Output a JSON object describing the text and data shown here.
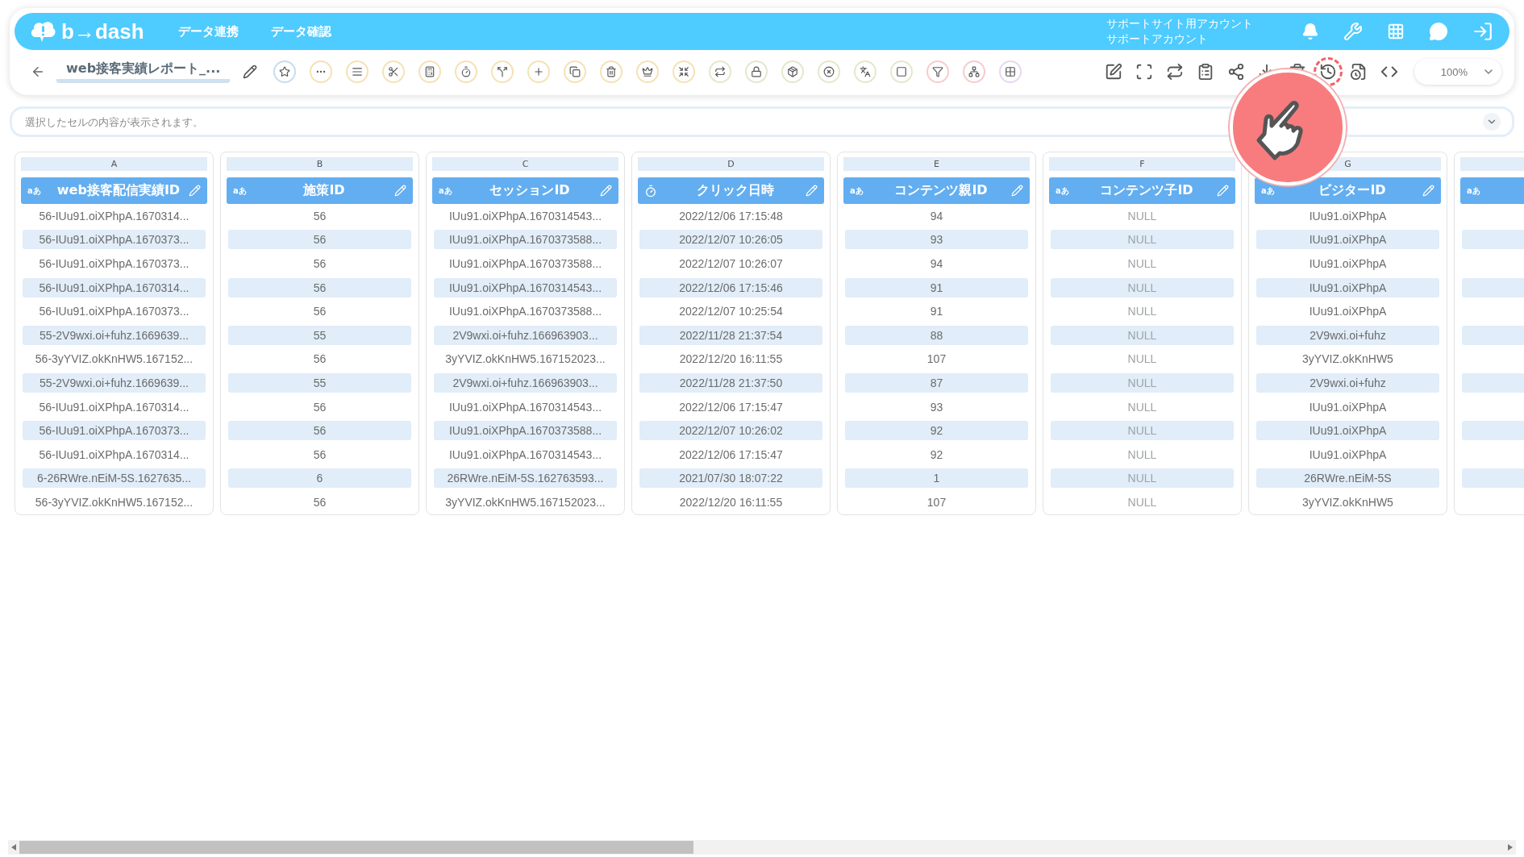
{
  "header": {
    "brand": "b→dash",
    "nav": [
      "データ連携",
      "データ確認"
    ],
    "account": [
      "サポートサイト用アカウント",
      "サポートアカウント"
    ]
  },
  "toolbar": {
    "report_title": "web接客実績レポート_...",
    "tools": [
      {
        "color": "#c9dcee"
      },
      {
        "color": "#f5e2b5"
      },
      {
        "color": "#f5e2b5"
      },
      {
        "color": "#f5e2b5"
      },
      {
        "color": "#f5e2b5"
      },
      {
        "color": "#f5e2b5"
      },
      {
        "color": "#f5e2b5"
      },
      {
        "color": "#f5e2b5"
      },
      {
        "color": "#f5e2b5"
      },
      {
        "color": "#f5e2b5"
      },
      {
        "color": "#f5e2b5"
      },
      {
        "color": "#f5e2b5"
      },
      {
        "color": "#e3e8cc"
      },
      {
        "color": "#e3e8cc"
      },
      {
        "color": "#e3e8cc"
      },
      {
        "color": "#e3e8cc"
      },
      {
        "color": "#e3e8cc"
      },
      {
        "color": "#e3e8cc"
      },
      {
        "color": "#f7cccc"
      },
      {
        "color": "#f7cccc"
      },
      {
        "color": "#ead6f2"
      }
    ],
    "actions": [
      {
        "highlighted": false
      },
      {
        "highlighted": false
      },
      {
        "highlighted": false
      },
      {
        "highlighted": false
      },
      {
        "highlighted": false
      },
      {
        "highlighted": false
      },
      {
        "highlighted": false
      },
      {
        "highlighted": true
      },
      {
        "highlighted": false
      },
      {
        "highlighted": false
      }
    ],
    "zoom": "100%"
  },
  "formula_bar": {
    "placeholder": "選択したセルの内容が表示されます。"
  },
  "columns": [
    {
      "letter": "A",
      "kind": "text",
      "type_label": "aあ",
      "title": "web接客配信実績ID",
      "dimmed": false,
      "cells": [
        "56-IUu91.oiXPhpA.1670314...",
        "56-IUu91.oiXPhpA.1670373...",
        "56-IUu91.oiXPhpA.1670373...",
        "56-IUu91.oiXPhpA.1670314...",
        "56-IUu91.oiXPhpA.1670373...",
        "55-2V9wxi.oi+fuhz.1669639...",
        "56-3yYVIZ.okKnHW5.167152...",
        "55-2V9wxi.oi+fuhz.1669639...",
        "56-IUu91.oiXPhpA.1670314...",
        "56-IUu91.oiXPhpA.1670373...",
        "56-IUu91.oiXPhpA.1670314...",
        "6-26RWre.nEiM-5S.1627635...",
        "56-3yYVIZ.okKnHW5.167152..."
      ]
    },
    {
      "letter": "B",
      "kind": "text",
      "type_label": "aあ",
      "title": "施策ID",
      "dimmed": false,
      "cells": [
        "56",
        "56",
        "56",
        "56",
        "56",
        "55",
        "56",
        "55",
        "56",
        "56",
        "56",
        "6",
        "56"
      ]
    },
    {
      "letter": "C",
      "kind": "text",
      "type_label": "aあ",
      "title": "セッションID",
      "dimmed": false,
      "cells": [
        "IUu91.oiXPhpA.1670314543...",
        "IUu91.oiXPhpA.1670373588...",
        "IUu91.oiXPhpA.1670373588...",
        "IUu91.oiXPhpA.1670314543...",
        "IUu91.oiXPhpA.1670373588...",
        "2V9wxi.oi+fuhz.166963903...",
        "3yYVIZ.okKnHW5.167152023...",
        "2V9wxi.oi+fuhz.166963903...",
        "IUu91.oiXPhpA.1670314543...",
        "IUu91.oiXPhpA.1670373588...",
        "IUu91.oiXPhpA.1670314543...",
        "26RWre.nEiM-5S.162763593...",
        "3yYVIZ.okKnHW5.167152023..."
      ]
    },
    {
      "letter": "D",
      "kind": "datetime",
      "title": "クリック日時",
      "dimmed": false,
      "cells": [
        "2022/12/06 17:15:48",
        "2022/12/07 10:26:05",
        "2022/12/07 10:26:07",
        "2022/12/06 17:15:46",
        "2022/12/07 10:25:54",
        "2022/11/28 21:37:54",
        "2022/12/20 16:11:55",
        "2022/11/28 21:37:50",
        "2022/12/06 17:15:47",
        "2022/12/07 10:26:02",
        "2022/12/06 17:15:47",
        "2021/07/30 18:07:22",
        "2022/12/20 16:11:55"
      ]
    },
    {
      "letter": "E",
      "kind": "text",
      "type_label": "aあ",
      "title": "コンテンツ親ID",
      "dimmed": false,
      "cells": [
        "94",
        "93",
        "94",
        "91",
        "91",
        "88",
        "107",
        "87",
        "93",
        "92",
        "92",
        "1",
        "107"
      ]
    },
    {
      "letter": "F",
      "kind": "text",
      "type_label": "aあ",
      "title": "コンテンツ子ID",
      "dimmed": true,
      "cells": [
        "NULL",
        "NULL",
        "NULL",
        "NULL",
        "NULL",
        "NULL",
        "NULL",
        "NULL",
        "NULL",
        "NULL",
        "NULL",
        "NULL",
        "NULL"
      ]
    },
    {
      "letter": "G",
      "kind": "text",
      "type_label": "aあ",
      "title": "ビジターID",
      "dimmed": false,
      "cells": [
        "IUu91.oiXPhpA",
        "IUu91.oiXPhpA",
        "IUu91.oiXPhpA",
        "IUu91.oiXPhpA",
        "IUu91.oiXPhpA",
        "2V9wxi.oi+fuhz",
        "3yYVIZ.okKnHW5",
        "2V9wxi.oi+fuhz",
        "IUu91.oiXPhpA",
        "IUu91.oiXPhpA",
        "IUu91.oiXPhpA",
        "26RWre.nEiM-5S",
        "3yYVIZ.okKnHW5"
      ]
    },
    {
      "kind": "text",
      "type_label": "aあ"
    }
  ]
}
